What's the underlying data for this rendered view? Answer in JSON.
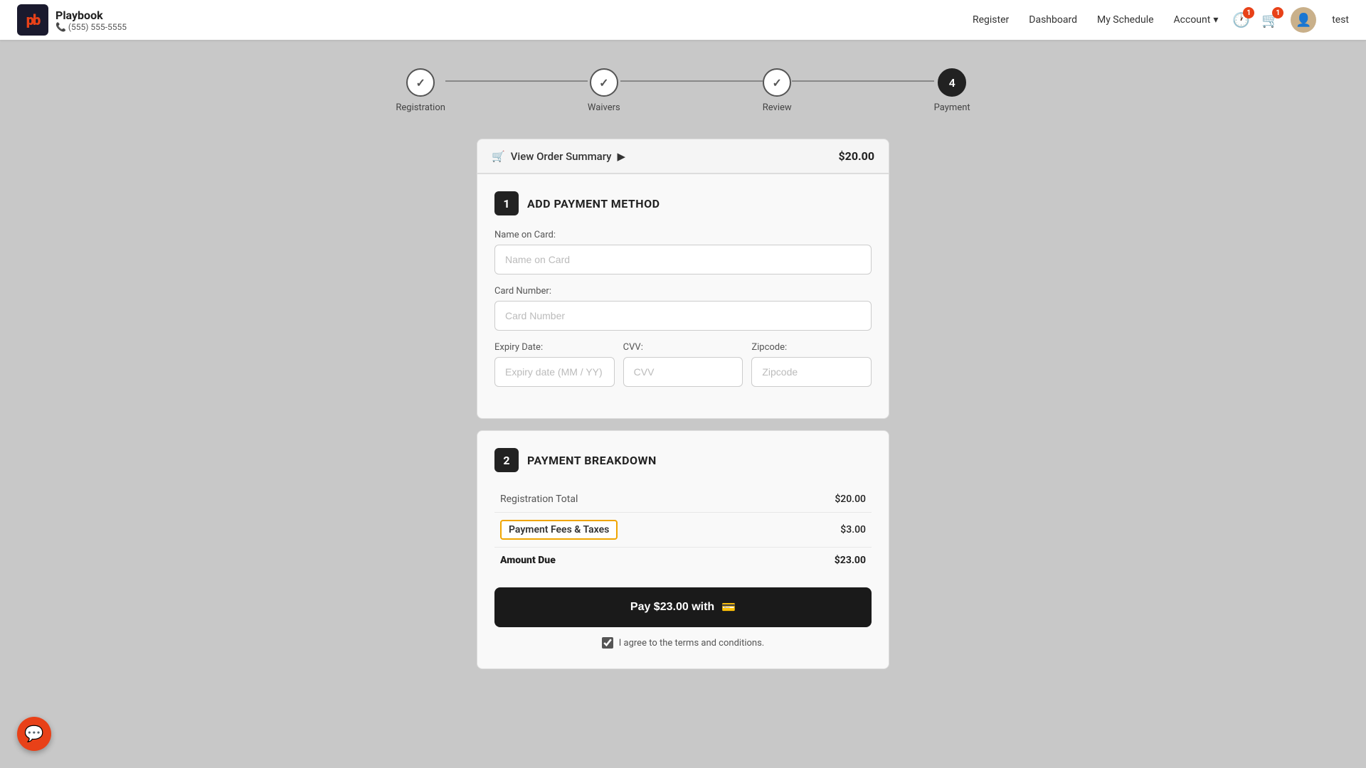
{
  "header": {
    "logo_text": "pb",
    "brand_name": "Playbook",
    "phone": "📞 (555) 555-5555",
    "nav": {
      "register": "Register",
      "dashboard": "Dashboard",
      "my_schedule": "My Schedule",
      "account": "Account",
      "account_chevron": "▾"
    },
    "notification_badge": "1",
    "cart_badge": "1",
    "user_name": "test"
  },
  "stepper": {
    "steps": [
      {
        "id": "registration",
        "label": "Registration",
        "state": "completed",
        "icon": "✓"
      },
      {
        "id": "waivers",
        "label": "Waivers",
        "state": "completed",
        "icon": "✓"
      },
      {
        "id": "review",
        "label": "Review",
        "state": "completed",
        "icon": "✓"
      },
      {
        "id": "payment",
        "label": "Payment",
        "state": "active",
        "number": "4"
      }
    ]
  },
  "order_summary": {
    "label": "View Order Summary",
    "chevron": "▶",
    "total": "$20.00"
  },
  "payment_method": {
    "section_number": "1",
    "section_title": "ADD PAYMENT METHOD",
    "name_on_card_label": "Name on Card:",
    "name_on_card_placeholder": "Name on Card",
    "card_number_label": "Card Number:",
    "card_number_placeholder": "Card Number",
    "expiry_label": "Expiry Date:",
    "expiry_placeholder": "Expiry date (MM / YY)",
    "cvv_label": "CVV:",
    "cvv_placeholder": "CVV",
    "zipcode_label": "Zipcode:",
    "zipcode_placeholder": "Zipcode"
  },
  "payment_breakdown": {
    "section_number": "2",
    "section_title": "PAYMENT BREAKDOWN",
    "rows": [
      {
        "label": "Registration Total",
        "value": "$20.00",
        "highlighted": false,
        "bold": false
      },
      {
        "label": "Payment Fees & Taxes",
        "value": "$3.00",
        "highlighted": true,
        "bold": false
      },
      {
        "label": "Amount Due",
        "value": "$23.00",
        "highlighted": false,
        "bold": true
      }
    ]
  },
  "pay_button": {
    "label": "Pay $23.00 with",
    "card_icon": "💳"
  },
  "terms": {
    "label": "I agree to the terms and conditions.",
    "checked": true
  },
  "chat_icon": "💬"
}
